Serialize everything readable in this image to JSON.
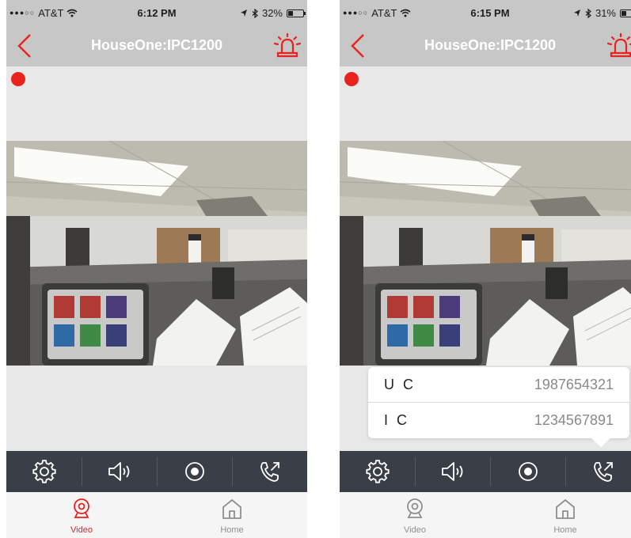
{
  "colors": {
    "accent": "#e8231e",
    "nav_bg": "#c7c7c7",
    "control_bg": "#3a3f47",
    "inactive_tab": "#8e8e8e"
  },
  "phones": [
    {
      "status": {
        "carrier": "AT&T",
        "time": "6:12 PM",
        "battery": "32%",
        "battery_level": 0.32
      },
      "title": "HouseOne:IPC1200",
      "tabs": [
        {
          "label": "Video",
          "icon": "webcam-icon"
        },
        {
          "label": "Home",
          "icon": "home-icon"
        }
      ],
      "active_tab": "Video"
    },
    {
      "status": {
        "carrier": "AT&T",
        "time": "6:15 PM",
        "battery": "31%",
        "battery_level": 0.31
      },
      "title": "HouseOne:IPC1200",
      "tabs": [
        {
          "label": "Video",
          "icon": "webcam-icon"
        },
        {
          "label": "Home",
          "icon": "home-icon"
        }
      ],
      "active_tab": "none",
      "call_menu": [
        {
          "name": "U C",
          "number": "1987654321"
        },
        {
          "name": "I C",
          "number": "1234567891"
        }
      ]
    }
  ],
  "controls": [
    "settings-icon",
    "speaker-icon",
    "record-icon",
    "phone-call-icon"
  ]
}
